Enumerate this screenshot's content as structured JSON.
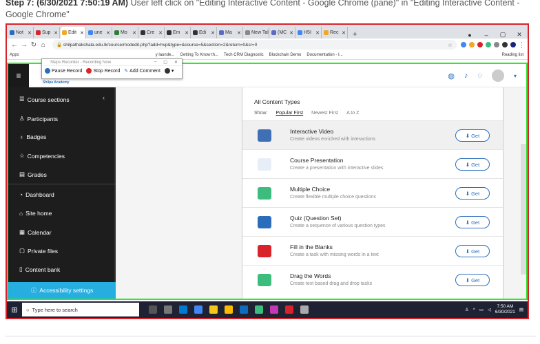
{
  "caption": {
    "step": "Step 7: (6/30/2021 7:50:19 AM)",
    "text": "User left click on \"Editing Interactive Content - Google Chrome (pane)\" in \"Editing Interactive Content - Google Chrome\""
  },
  "browser": {
    "tabs": [
      {
        "label": "Not",
        "color": "#2a6ebb"
      },
      {
        "label": "Sup",
        "color": "#d8232a"
      },
      {
        "label": "Edit",
        "color": "#f5a623",
        "active": true
      },
      {
        "label": "une",
        "color": "#4285f4"
      },
      {
        "label": "Mo",
        "color": "#2e7d32"
      },
      {
        "label": "Cre",
        "color": "#333333"
      },
      {
        "label": "Em",
        "color": "#333333"
      },
      {
        "label": "Edi",
        "color": "#333333"
      },
      {
        "label": "Ma",
        "color": "#5c6bc0"
      },
      {
        "label": "New Tal",
        "color": "#888888"
      },
      {
        "label": "(MC",
        "color": "#5c6bc0"
      },
      {
        "label": "H5I",
        "color": "#4285f4"
      },
      {
        "label": "Rec",
        "color": "#f5a623"
      }
    ],
    "url": "shilpathakshala.edu.lk/course/modedit.php?add=hvp&type=&course=5&section=2&return=0&sr=0",
    "bookmarks": [
      "Apps",
      "y launde...",
      "Getting To Know th...",
      "Tech CRM Diagnostic",
      "Blockchain Demo",
      "Documentation - I...",
      "Reading list"
    ]
  },
  "steps_recorder": {
    "title": "Steps Recorder - Recording Now",
    "pause": "Pause Record",
    "stop": "Stop Record",
    "comment": "Add Comment"
  },
  "site": {
    "brand": "Shilpa Academy"
  },
  "sidebar": {
    "items": [
      {
        "label": "Course sections",
        "icon": "list-icon",
        "glyph": "☰"
      },
      {
        "label": "Participants",
        "icon": "users-icon",
        "glyph": "♙"
      },
      {
        "label": "Badges",
        "icon": "badge-icon",
        "glyph": "♁"
      },
      {
        "label": "Competencies",
        "icon": "star-icon",
        "glyph": "☆"
      },
      {
        "label": "Grades",
        "icon": "grades-icon",
        "glyph": "▤"
      },
      {
        "label": "Dashboard",
        "icon": "dashboard-icon",
        "glyph": "◔"
      },
      {
        "label": "Site home",
        "icon": "home-icon",
        "glyph": "⌂"
      },
      {
        "label": "Calendar",
        "icon": "calendar-icon",
        "glyph": "▦"
      },
      {
        "label": "Private files",
        "icon": "file-icon",
        "glyph": "▢"
      },
      {
        "label": "Content bank",
        "icon": "bank-icon",
        "glyph": "▯"
      }
    ],
    "accessibility": "Accessibility settings"
  },
  "content_types": {
    "heading": "All Content Types",
    "show_label": "Show:",
    "sort_options": [
      "Popular First",
      "Newest First",
      "A to Z"
    ],
    "get_label": "Get",
    "items": [
      {
        "name": "Interactive Video",
        "desc": "Create videos enriched with interactions",
        "color": "#3f6fb5"
      },
      {
        "name": "Course Presentation",
        "desc": "Create a presentation with interactive slides",
        "color": "#e8eef7"
      },
      {
        "name": "Multiple Choice",
        "desc": "Create flexible multiple choice questions",
        "color": "#3dbd7d"
      },
      {
        "name": "Quiz (Question Set)",
        "desc": "Create a sequence of various question types",
        "color": "#2a6ebb"
      },
      {
        "name": "Fill in the Blanks",
        "desc": "Create a task with missing words in a text",
        "color": "#d8232a"
      },
      {
        "name": "Drag the Words",
        "desc": "Create text based drag and drop tasks",
        "color": "#3dbd7d"
      }
    ]
  },
  "taskbar": {
    "search_placeholder": "Type here to search",
    "time": "7:50 AM",
    "date": "6/30/2021"
  }
}
